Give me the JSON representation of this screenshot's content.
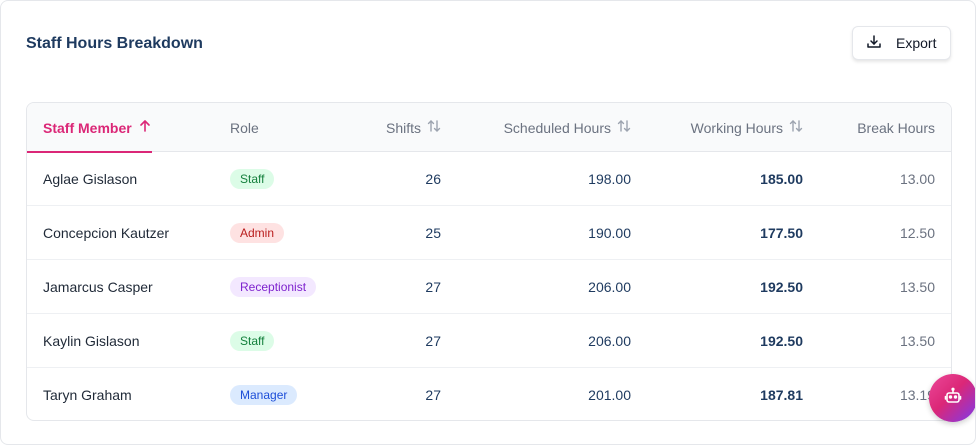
{
  "header": {
    "title": "Staff Hours Breakdown",
    "export_label": "Export"
  },
  "table": {
    "columns": [
      {
        "label": "Staff Member",
        "sort": "ascending"
      },
      {
        "label": "Role",
        "sort": "none"
      },
      {
        "label": "Shifts",
        "sort": "sortable"
      },
      {
        "label": "Scheduled Hours",
        "sort": "sortable"
      },
      {
        "label": "Working Hours",
        "sort": "sortable"
      },
      {
        "label": "Break Hours",
        "sort": "none"
      }
    ],
    "rows": [
      {
        "name": "Aglae Gislason",
        "role": "Staff",
        "shifts": "26",
        "scheduled": "198.00",
        "working": "185.00",
        "break": "13.00"
      },
      {
        "name": "Concepcion Kautzer",
        "role": "Admin",
        "shifts": "25",
        "scheduled": "190.00",
        "working": "177.50",
        "break": "12.50"
      },
      {
        "name": "Jamarcus Casper",
        "role": "Receptionist",
        "shifts": "27",
        "scheduled": "206.00",
        "working": "192.50",
        "break": "13.50"
      },
      {
        "name": "Kaylin Gislason",
        "role": "Staff",
        "shifts": "27",
        "scheduled": "206.00",
        "working": "192.50",
        "break": "13.50"
      },
      {
        "name": "Taryn Graham",
        "role": "Manager",
        "shifts": "27",
        "scheduled": "201.00",
        "working": "187.81",
        "break": "13.19"
      }
    ]
  },
  "role_colors": {
    "Staff": {
      "bg": "#dcfce7",
      "fg": "#15803d"
    },
    "Admin": {
      "bg": "#fee2e2",
      "fg": "#b91c1c"
    },
    "Receptionist": {
      "bg": "#f3e8ff",
      "fg": "#7e22ce"
    },
    "Manager": {
      "bg": "#dbeafe",
      "fg": "#1d4ed8"
    }
  },
  "accent_color": "#db2777",
  "icons": {
    "export": "download-icon",
    "sort_asc": "arrow-up-icon",
    "sortable": "sort-arrows-icon",
    "assistant": "robot-icon"
  }
}
